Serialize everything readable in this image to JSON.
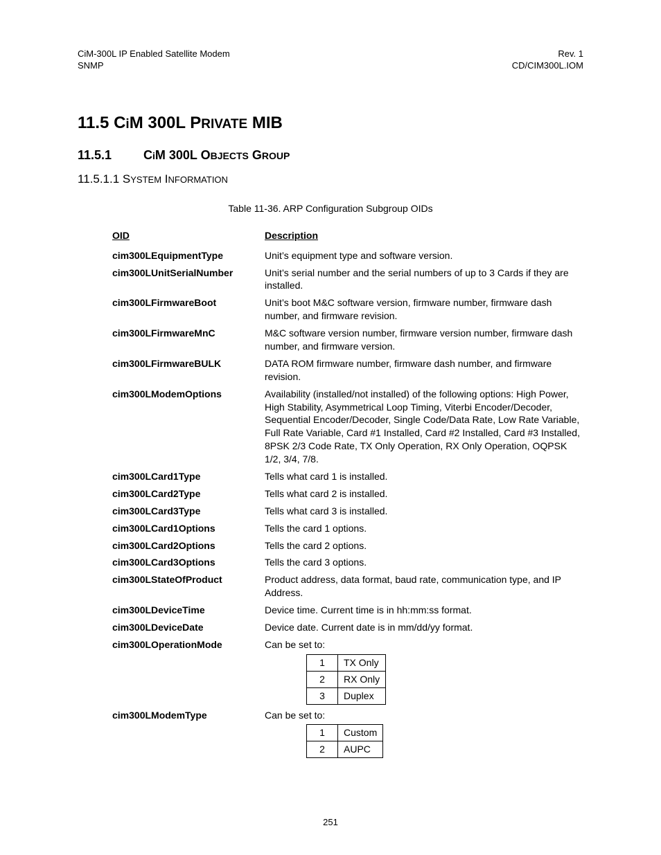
{
  "header": {
    "left_line1": "CiM-300L IP Enabled Satellite Modem",
    "left_line2": "SNMP",
    "right_line1": "Rev. 1",
    "right_line2": "CD/CIM300L.IOM"
  },
  "headings": {
    "h1_num": "11.5",
    "h1_text_1": "C",
    "h1_text_2": "i",
    "h1_text_3": "M 300L P",
    "h1_text_4": "RIVATE",
    "h1_text_5": " MIB",
    "h2_num": "11.5.1",
    "h2_text_1": "C",
    "h2_text_2": "i",
    "h2_text_3": "M 300L O",
    "h2_text_4": "BJECTS",
    "h2_text_5": " G",
    "h2_text_6": "ROUP",
    "h3_num": "11.5.1.1",
    "h3_text_1": "S",
    "h3_text_2": "YSTEM",
    "h3_text_3": " I",
    "h3_text_4": "NFORMATION"
  },
  "table_caption": "Table 11-36.  ARP Configuration Subgroup OIDs",
  "columns": {
    "oid": "OID",
    "desc": "Description"
  },
  "rows": [
    {
      "oid": "cim300LEquipmentType",
      "desc": "Unit’s equipment type and software version."
    },
    {
      "oid": "cim300LUnitSerialNumber",
      "desc": "Unit’s serial number and the serial numbers of up to 3 Cards if they are installed."
    },
    {
      "oid": "cim300LFirmwareBoot",
      "desc": "Unit’s boot M&C software version, firmware number, firmware dash number, and firmware revision."
    },
    {
      "oid": "cim300LFirmwareMnC",
      "desc": "M&C software version number, firmware version number, firmware dash number, and firmware version."
    },
    {
      "oid": "cim300LFirmwareBULK",
      "desc": "DATA ROM firmware number, firmware dash number, and firmware revision."
    },
    {
      "oid": "cim300LModemOptions",
      "desc": "Availability (installed/not installed) of the following options: High Power, High Stability, Asymmetrical Loop Timing, Viterbi Encoder/Decoder, Sequential Encoder/Decoder, Single Code/Data Rate, Low Rate Variable, Full Rate Variable, Card #1 Installed, Card #2 Installed, Card #3 Installed, 8PSK 2/3 Code Rate, TX Only Operation, RX Only Operation, OQPSK 1/2, 3/4, 7/8."
    },
    {
      "oid": "cim300LCard1Type",
      "desc": "Tells what card 1 is installed."
    },
    {
      "oid": "cim300LCard2Type",
      "desc": "Tells what card 2 is installed."
    },
    {
      "oid": "cim300LCard3Type",
      "desc": "Tells what card 3 is installed."
    },
    {
      "oid": "cim300LCard1Options",
      "desc": "Tells the card 1 options."
    },
    {
      "oid": "cim300LCard2Options",
      "desc": "Tells the card 2 options."
    },
    {
      "oid": "cim300LCard3Options",
      "desc": "Tells the card 3 options."
    },
    {
      "oid": "cim300LStateOfProduct",
      "desc": "Product address, data format, baud rate, communication type, and IP Address."
    },
    {
      "oid": "cim300LDeviceTime",
      "desc": "Device time. Current time is in hh:mm:ss format."
    },
    {
      "oid": "cim300LDeviceDate",
      "desc": "Device date. Current date is in mm/dd/yy format."
    },
    {
      "oid": "cim300LOperationMode",
      "desc": "Can be set to:",
      "sub": [
        {
          "n": "1",
          "v": "TX Only"
        },
        {
          "n": "2",
          "v": "RX Only"
        },
        {
          "n": "3",
          "v": "Duplex"
        }
      ]
    },
    {
      "oid": "cim300LModemType",
      "desc": "Can be set to:",
      "sub": [
        {
          "n": "1",
          "v": "Custom"
        },
        {
          "n": "2",
          "v": "AUPC"
        }
      ]
    }
  ],
  "footer": {
    "page": "251"
  }
}
